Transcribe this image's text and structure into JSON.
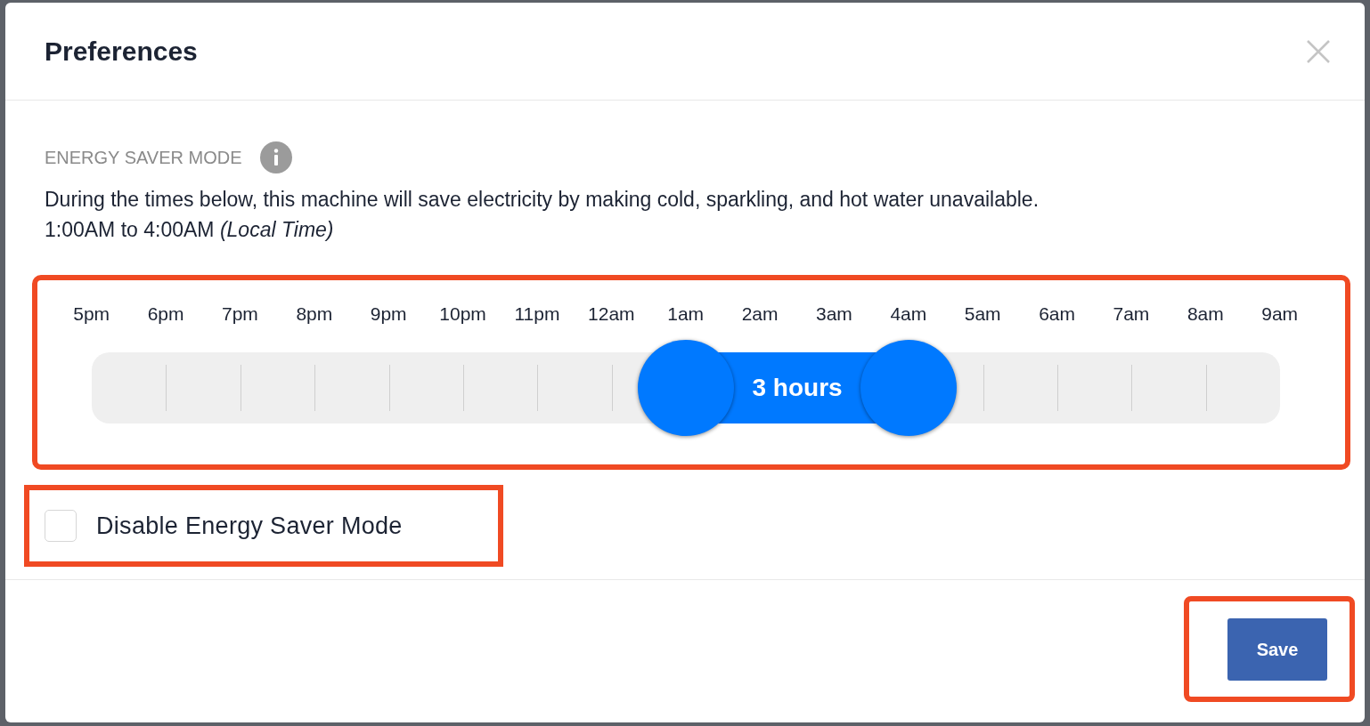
{
  "dialog": {
    "title": "Preferences"
  },
  "section": {
    "label": "ENERGY SAVER MODE",
    "description": "During the times below, this machine will save electricity by making cold, sparkling, and hot water unavailable.",
    "schedule": "1:00AM to 4:00AM *(Local Time)*"
  },
  "slider": {
    "duration": "3 hours",
    "hours": [
      "5pm",
      "6pm",
      "7pm",
      "8pm",
      "9pm",
      "10pm",
      "11pm",
      "12am",
      "1am",
      "2am",
      "3am",
      "4am",
      "5am",
      "6am",
      "7am",
      "8am",
      "9am"
    ],
    "handles": [
      {
        "level": 0.5
      },
      {
        "level": 0.6875
      }
    ]
  },
  "disable_checkbox": {
    "label": "Disable Energy Saver Mode",
    "checked": false
  },
  "buttons": [
    {
      "label": "Save"
    }
  ]
}
